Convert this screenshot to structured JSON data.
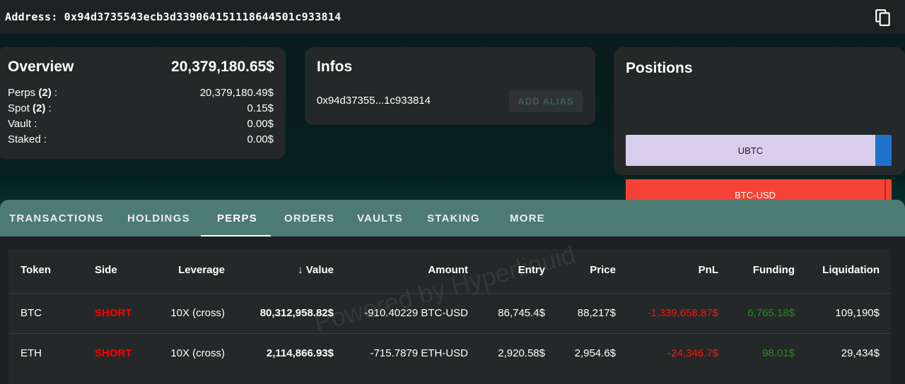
{
  "address_bar": {
    "label": "Address:",
    "value": "0x94d3735543ecb3d339064151118644501c933814",
    "copy_icon": "copy-icon"
  },
  "overview": {
    "title": "Overview",
    "total": "20,379,180.65$",
    "rows": [
      {
        "label": "Perps",
        "count": "(2)",
        "suffix": " :",
        "value": "20,379,180.49$"
      },
      {
        "label": "Spot",
        "count": "(2)",
        "suffix": " :",
        "value": "0.15$"
      },
      {
        "label": "Vault :",
        "count": "",
        "suffix": "",
        "value": "0.00$"
      },
      {
        "label": "Staked :",
        "count": "",
        "suffix": "",
        "value": "0.00$"
      }
    ]
  },
  "infos": {
    "title": "Infos",
    "short_address": "0x94d37355...1c933814",
    "add_alias_label": "ADD ALIAS"
  },
  "positions": {
    "title": "Positions",
    "bars": [
      {
        "label": "UBTC",
        "color": "#d9cdee",
        "accent": "#1e73c9"
      },
      {
        "label": "BTC-USD",
        "color": "#f44336",
        "accent": "#f44336"
      }
    ]
  },
  "tabs": {
    "items": [
      "TRANSACTIONS",
      "HOLDINGS",
      "PERPS",
      "ORDERS",
      "VAULTS",
      "STAKING",
      "MORE"
    ],
    "active": "PERPS"
  },
  "table": {
    "headers": {
      "token": "Token",
      "side": "Side",
      "leverage": "Leverage",
      "value_arrow": "↓",
      "value": "Value",
      "amount": "Amount",
      "entry": "Entry",
      "price": "Price",
      "pnl": "PnL",
      "funding": "Funding",
      "liquidation": "Liquidation"
    },
    "rows": [
      {
        "token": "BTC",
        "side": "SHORT",
        "leverage": "10X (cross)",
        "value": "80,312,958.82$",
        "amount": "-910.40229 BTC-USD",
        "entry": "86,745.4$",
        "price": "88,217$",
        "pnl": "-1,339,658.87$",
        "funding": "6,765.18$",
        "liquidation": "109,190$"
      },
      {
        "token": "ETH",
        "side": "SHORT",
        "leverage": "10X (cross)",
        "value": "2,114,866.93$",
        "amount": "-715.7879 ETH-USD",
        "entry": "2,920.58$",
        "price": "2,954.6$",
        "pnl": "-24,346.7$",
        "funding": "98.01$",
        "liquidation": "29,434$"
      }
    ]
  },
  "watermark": "Powered by Hyperliquid",
  "colors": {
    "short": "#ff0000",
    "negative": "#ff1111",
    "positive": "#1e8f1e",
    "tab_bar": "#4d7a72"
  }
}
